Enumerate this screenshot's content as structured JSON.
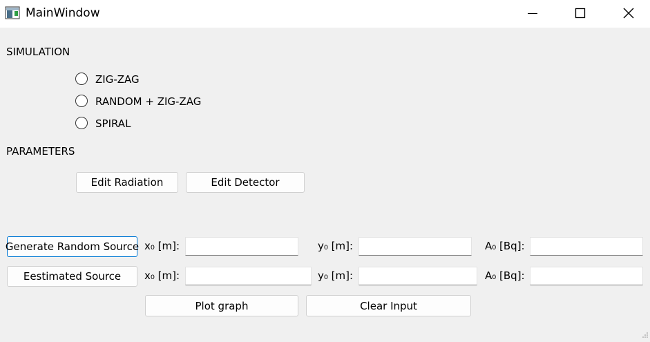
{
  "window": {
    "title": "MainWindow",
    "icons": {
      "app": "window-app-icon",
      "minimize": "minimize-icon",
      "maximize": "maximize-icon",
      "close": "close-icon"
    }
  },
  "simulation": {
    "heading": "SIMULATION",
    "options": [
      {
        "label": "ZIG-ZAG",
        "checked": false
      },
      {
        "label": "RANDOM + ZIG-ZAG",
        "checked": false
      },
      {
        "label": "SPIRAL",
        "checked": false
      }
    ]
  },
  "parameters": {
    "heading": "PARAMETERS",
    "edit_radiation_label": "Edit Radiation",
    "edit_detector_label": "Edit Detector"
  },
  "random_source": {
    "button_label": "Generate Random Source",
    "x_label": "x₀ [m]:",
    "y_label": "y₀ [m]:",
    "a_label": "A₀ [Bq]:",
    "x_value": "",
    "y_value": "",
    "a_value": ""
  },
  "estimated_source": {
    "button_label": "Eestimated Source",
    "x_label": "x₀ [m]:",
    "y_label": "y₀ [m]:",
    "a_label": "A₀ [Bq]:",
    "x_value": "",
    "y_value": "",
    "a_value": ""
  },
  "actions": {
    "plot_label": "Plot graph",
    "clear_label": "Clear Input"
  },
  "colors": {
    "focus_border": "#0078d4",
    "background": "#f0f0f0",
    "titlebar": "#ffffff"
  }
}
